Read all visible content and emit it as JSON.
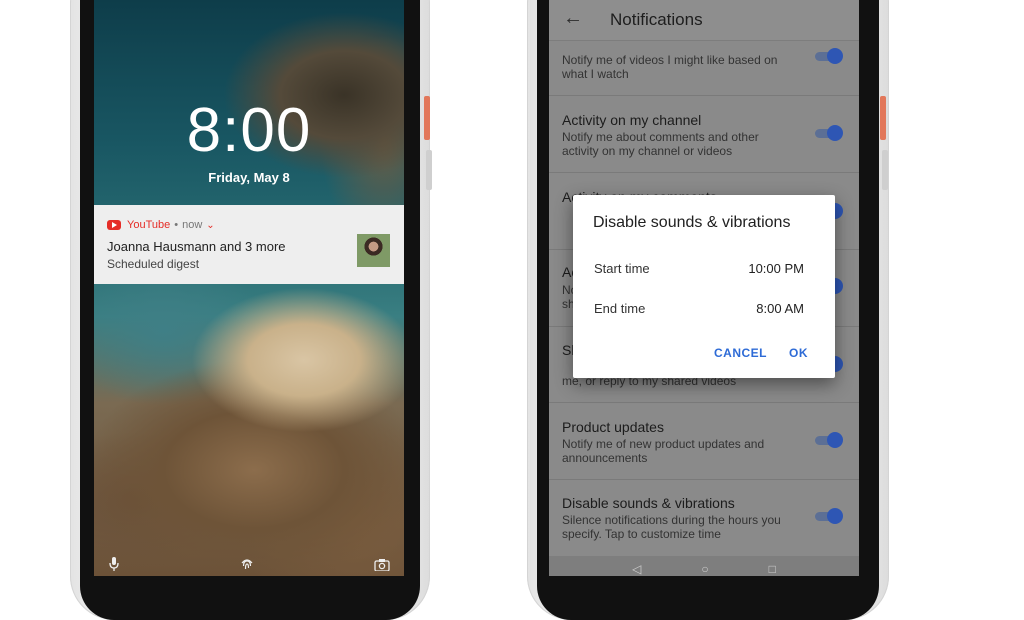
{
  "lock_screen": {
    "time": "8:00",
    "date": "Friday, May 8",
    "notification": {
      "app_name": "YouTube",
      "separator": "•",
      "when": "now",
      "title": "Joanna Hausmann and 3 more",
      "text": "Scheduled digest"
    },
    "bottom_icons": [
      "microphone-icon",
      "fingerprint-icon",
      "camera-icon"
    ]
  },
  "settings": {
    "title": "Notifications",
    "rows": [
      {
        "title": "",
        "subtitle": "Notify me of videos I might like based on what I watch"
      },
      {
        "title": "Activity on my channel",
        "subtitle": "Notify me about comments and other activity on my channel or videos"
      },
      {
        "title": "Activity on my comments",
        "subtitle": ""
      },
      {
        "title": "Ac",
        "subtitle": "No sh"
      },
      {
        "title": "Sh",
        "subtitle": "me, or reply to my shared videos"
      },
      {
        "title": "Product updates",
        "subtitle": "Notify me of new product updates and announcements"
      },
      {
        "title": "Disable sounds & vibrations",
        "subtitle": "Silence notifications during the hours you specify. Tap to customize time"
      }
    ]
  },
  "dialog": {
    "title": "Disable sounds & vibrations",
    "start_label": "Start time",
    "start_value": "10:00 PM",
    "end_label": "End time",
    "end_value": "8:00 AM",
    "cancel": "CANCEL",
    "ok": "OK"
  },
  "colors": {
    "accent": "#2e6bd6",
    "youtube_red": "#e52d27",
    "toggle": "#2e56b4",
    "phone_button": "#e2775a"
  }
}
